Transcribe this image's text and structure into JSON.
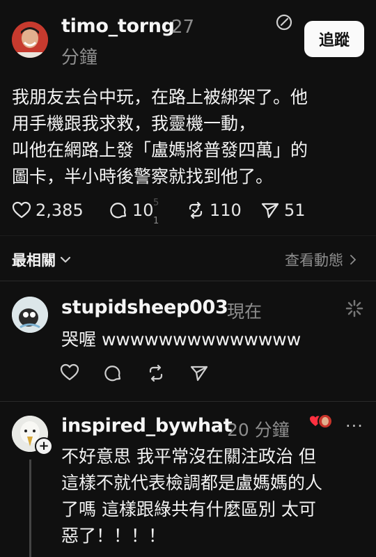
{
  "post": {
    "author": "timo_torng",
    "time_line1": "27",
    "time_line2": "分鐘",
    "follow_label": "追蹤",
    "text_lines": [
      "我朋友去台中玩，在路上被綁架了。他",
      "用手機跟我求救，我靈機一動，",
      "叫他在網路上發「盧媽將普發四萬」的",
      "圖卡，半小時後警察就找到他了。"
    ],
    "likes": "2,385",
    "comments": "10",
    "comments_sub_top": "5",
    "comments_sub_bottom": "1",
    "reposts": "110",
    "shares": "51"
  },
  "sort": {
    "label": "最相關",
    "activity_label": "查看動態"
  },
  "replies": [
    {
      "author": "stupidsheep003",
      "time": "現在",
      "text": "哭喔 wwwwwwwwwwwwww"
    },
    {
      "author": "inspired_bywhat",
      "time": "20 分鐘",
      "text_lines": [
        "不好意思 我平常沒在關注政治 但",
        "這樣不就代表檢調都是盧媽媽的人",
        "了嗎 這樣跟綠共有什麼區別 太可",
        "惡了！！！！"
      ]
    }
  ],
  "colors": {
    "background": "#101010",
    "text": "#f3f3f3",
    "muted": "#8d8d8d",
    "liked_heart": "#ff3040"
  }
}
